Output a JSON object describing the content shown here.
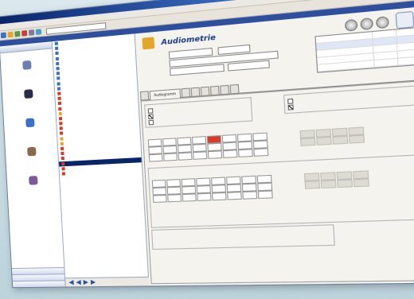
{
  "window": {
    "title": "",
    "search_text": ""
  },
  "header": {
    "title": "Audiometrie"
  },
  "listtable": {
    "rows": [
      [
        "",
        "",
        ""
      ],
      [
        "",
        "",
        ""
      ],
      [
        "",
        "",
        ""
      ],
      [
        "",
        "",
        ""
      ],
      [
        "",
        "",
        ""
      ]
    ]
  },
  "tabs": {
    "active": "Audiogramm"
  },
  "grid": {
    "row1": [
      "",
      "",
      "",
      "",
      "",
      "",
      "",
      "",
      "",
      "",
      "",
      "",
      "",
      ""
    ],
    "row2": [
      "",
      "",
      "",
      "",
      "",
      "",
      "",
      "",
      "",
      "",
      "",
      "",
      "",
      ""
    ]
  },
  "colors": {
    "title_blue": "#0a246a",
    "accent_red": "#d9392b",
    "orange": "#e3a52a"
  }
}
